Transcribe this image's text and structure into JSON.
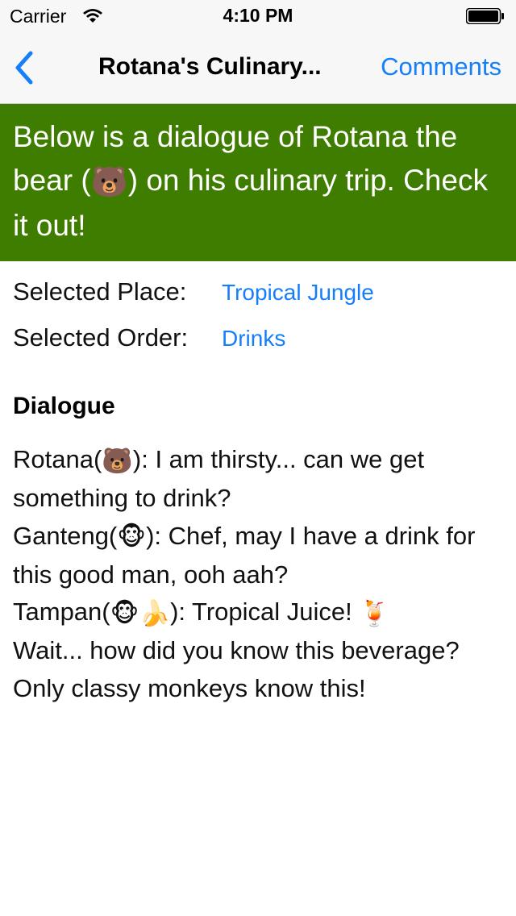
{
  "status_bar": {
    "carrier": "Carrier",
    "time": "4:10 PM",
    "wifi_icon": "wifi-icon",
    "battery_icon": "battery-full-icon"
  },
  "nav": {
    "back_icon": "chevron-left-icon",
    "title": "Rotana's Culinary...",
    "right_button": "Comments",
    "accent_color": "#147efb"
  },
  "banner": {
    "text_before_emoji": "Below is a dialogue of Rotana the bear (",
    "emoji": "🐻",
    "text_after_emoji": ") on his culinary trip. Check it out!",
    "background_color": "#3f7d00"
  },
  "selection": {
    "place_label": "Selected Place:",
    "place_value": "Tropical Jungle",
    "order_label": "Selected Order:",
    "order_value": "Drinks"
  },
  "dialogue": {
    "heading": "Dialogue",
    "lines": [
      {
        "speaker": "Rotana(",
        "emoji": "🐻",
        "text": "): I am thirsty... can we get something to drink?"
      },
      {
        "speaker": "Ganteng(",
        "emoji": "🐵",
        "text": "): Chef, may I have a drink for this good man, ooh aah?"
      },
      {
        "speaker": "Tampan(",
        "emoji": "🐵🍌",
        "text": "): Tropical Juice! ",
        "trailing_emoji": "🍹",
        "continuation": "Wait... how did you know this beverage? Only classy monkeys know this!"
      }
    ]
  }
}
